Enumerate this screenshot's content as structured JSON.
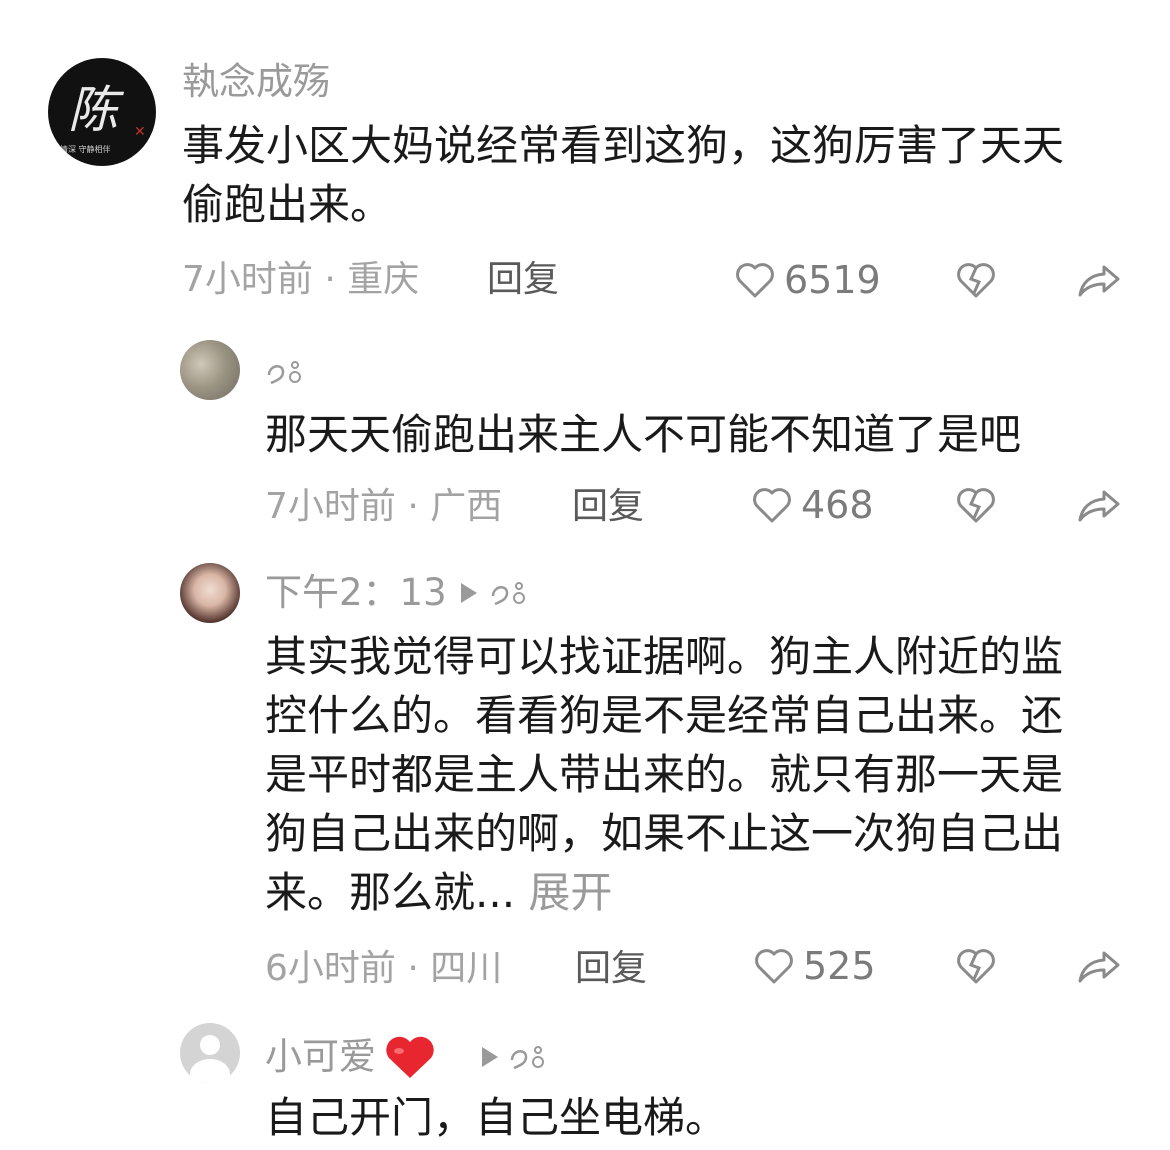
{
  "comments": [
    {
      "user": "執念成殇",
      "text": "事发小区大妈说经常看到这狗，这狗厉害了天天偷跑出来。",
      "meta": "7小时前 · 重庆",
      "reply": "回复",
      "likes": "6519",
      "avatar_char": "陈",
      "avatar_caption": "往情深 守静相伴"
    },
    {
      "user": "",
      "text": "那天天偷跑出来主人不可能不知道了是吧",
      "meta": "7小时前 · 广西",
      "reply": "回复",
      "likes": "468"
    },
    {
      "user": "下午2：13",
      "text": "其实我觉得可以找证据啊。狗主人附近的监控什么的。看看狗是不是经常自己出来。还是平时都是主人带出来的。就只有那一天是狗自己出来的啊，如果不止这一次狗自己出来。那么就...",
      "expand": "展开",
      "meta": "6小时前 · 四川",
      "reply": "回复",
      "likes": "525"
    },
    {
      "user": "小可爱",
      "text": "自己开门，自己坐电梯。"
    }
  ],
  "colors": {
    "text": "#1a1a1a",
    "muted": "#9a9a9a",
    "heart_emoji": "#e8262f"
  },
  "icons": [
    "heart-outline-icon",
    "broken-heart-icon",
    "share-icon",
    "reply-arrow-icon",
    "emoji-tag-icon",
    "heart-emoji-icon"
  ]
}
